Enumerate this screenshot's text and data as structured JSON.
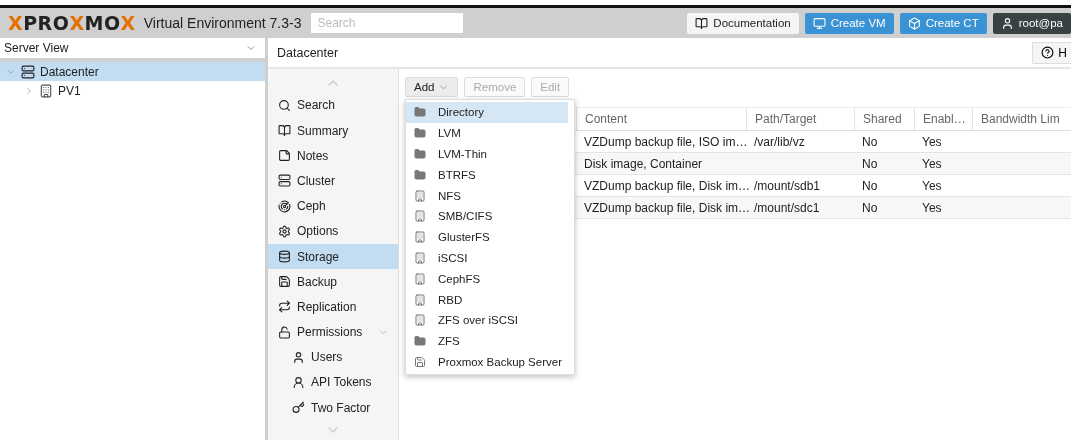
{
  "header": {
    "logo": [
      {
        "text": "X",
        "accent": true
      },
      {
        "text": "PRO",
        "accent": false
      },
      {
        "text": "X",
        "accent": true
      },
      {
        "text": "MO",
        "accent": false
      },
      {
        "text": "X",
        "accent": true
      }
    ],
    "product": "Virtual Environment 7.3-3",
    "search": {
      "placeholder": "Search"
    },
    "buttons": [
      {
        "kind": "doc",
        "label": "Documentation"
      },
      {
        "kind": "vm",
        "label": "Create VM"
      },
      {
        "kind": "ct",
        "label": "Create CT"
      },
      {
        "kind": "user",
        "label": "root@pa"
      }
    ]
  },
  "tree": {
    "view": "Server View",
    "items": [
      {
        "label": "Datacenter",
        "kind": "datacenter",
        "selected": true,
        "expanded": true,
        "children": [
          {
            "label": "PV1",
            "kind": "node",
            "selected": false,
            "expanded": false
          }
        ]
      }
    ]
  },
  "panel": {
    "title": "Datacenter",
    "help": "H"
  },
  "nav": [
    {
      "label": "Search",
      "kind": "search",
      "selected": false,
      "sub": false
    },
    {
      "label": "Summary",
      "kind": "book",
      "selected": false,
      "sub": false
    },
    {
      "label": "Notes",
      "kind": "note",
      "selected": false,
      "sub": false
    },
    {
      "label": "Cluster",
      "kind": "server",
      "selected": false,
      "sub": false
    },
    {
      "label": "Ceph",
      "kind": "ceph",
      "selected": false,
      "sub": false
    },
    {
      "label": "Options",
      "kind": "gear",
      "selected": false,
      "sub": false
    },
    {
      "label": "Storage",
      "kind": "db",
      "selected": true,
      "sub": false
    },
    {
      "label": "Backup",
      "kind": "floppy",
      "selected": false,
      "sub": false
    },
    {
      "label": "Replication",
      "kind": "repeat",
      "selected": false,
      "sub": false
    },
    {
      "label": "Permissions",
      "kind": "unlock",
      "selected": false,
      "sub": false,
      "expandable": true
    },
    {
      "label": "Users",
      "kind": "user",
      "selected": false,
      "sub": true
    },
    {
      "label": "API Tokens",
      "kind": "userline",
      "selected": false,
      "sub": true
    },
    {
      "label": "Two Factor",
      "kind": "key",
      "selected": false,
      "sub": true
    }
  ],
  "toolbar": [
    {
      "label": "Add",
      "disabled": false,
      "menu": true
    },
    {
      "label": "Remove",
      "disabled": true,
      "menu": false
    },
    {
      "label": "Edit",
      "disabled": true,
      "menu": false
    }
  ],
  "table": {
    "columns": [
      "Content",
      "Path/Target",
      "Shared",
      "Enabl…",
      "Bandwidth Lim"
    ],
    "rows": [
      [
        "VZDump backup file, ISO im…",
        "/var/lib/vz",
        "No",
        "Yes"
      ],
      [
        "Disk image, Container",
        "",
        "No",
        "Yes"
      ],
      [
        "VZDump backup file, Disk im…",
        "/mount/sdb1",
        "No",
        "Yes"
      ],
      [
        "VZDump backup file, Disk im…",
        "/mount/sdc1",
        "No",
        "Yes"
      ]
    ]
  },
  "add_menu": [
    {
      "label": "Directory",
      "kind": "folder",
      "selected": true
    },
    {
      "label": "LVM",
      "kind": "folder",
      "selected": false
    },
    {
      "label": "LVM-Thin",
      "kind": "folder",
      "selected": false
    },
    {
      "label": "BTRFS",
      "kind": "folder",
      "selected": false
    },
    {
      "label": "NFS",
      "kind": "building",
      "selected": false
    },
    {
      "label": "SMB/CIFS",
      "kind": "building",
      "selected": false
    },
    {
      "label": "GlusterFS",
      "kind": "building",
      "selected": false
    },
    {
      "label": "iSCSI",
      "kind": "building",
      "selected": false
    },
    {
      "label": "CephFS",
      "kind": "building",
      "selected": false
    },
    {
      "label": "RBD",
      "kind": "building",
      "selected": false
    },
    {
      "label": "ZFS over iSCSI",
      "kind": "building",
      "selected": false
    },
    {
      "label": "ZFS",
      "kind": "folder",
      "selected": false
    },
    {
      "label": "Proxmox Backup Server",
      "kind": "floppy",
      "selected": false
    }
  ]
}
